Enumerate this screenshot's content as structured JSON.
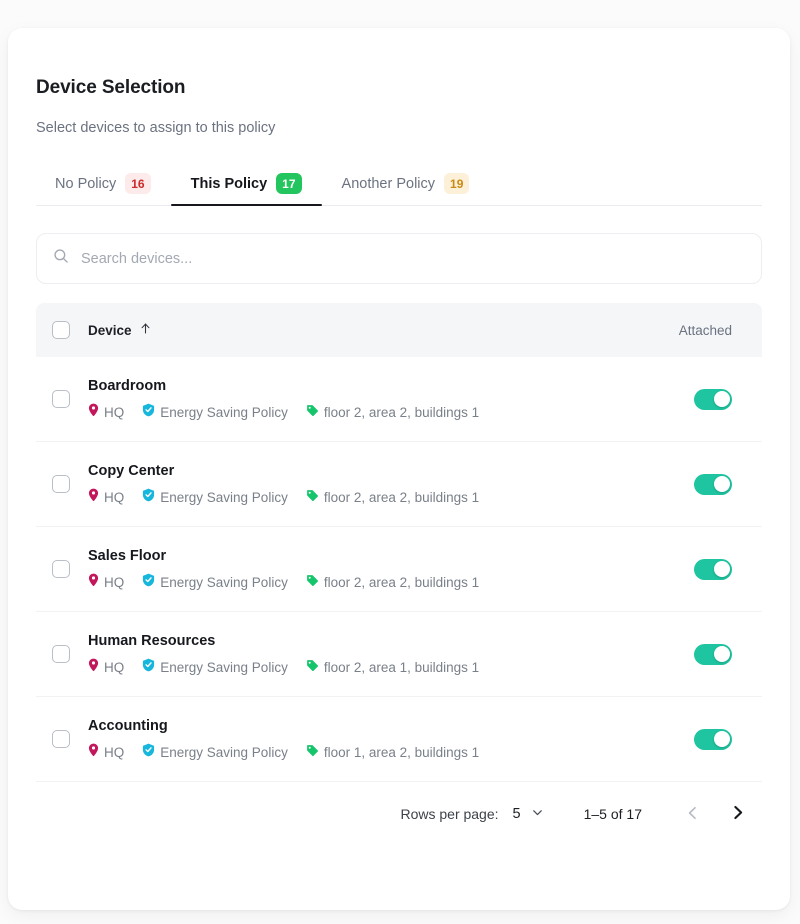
{
  "header": {
    "title": "Device Selection",
    "subtitle": "Select devices to assign to this policy"
  },
  "tabs": [
    {
      "label": "No Policy",
      "count": "16",
      "badge_style": "red",
      "active": false
    },
    {
      "label": "This Policy",
      "count": "17",
      "badge_style": "green",
      "active": true
    },
    {
      "label": "Another Policy",
      "count": "19",
      "badge_style": "amber",
      "active": false
    }
  ],
  "search": {
    "placeholder": "Search devices...",
    "value": "",
    "icon": "search-icon"
  },
  "table": {
    "columns": {
      "device": "Device",
      "attached": "Attached"
    },
    "sort": {
      "column": "Device",
      "direction": "ascending",
      "icon": "arrow-up-icon"
    },
    "select_all_checked": false,
    "rows": [
      {
        "name": "Boardroom",
        "site": "HQ",
        "policy": "Energy Saving Policy",
        "tags": "floor 2, area 2, buildings 1",
        "selected": false,
        "attached": true
      },
      {
        "name": "Copy Center",
        "site": "HQ",
        "policy": "Energy Saving Policy",
        "tags": "floor 2, area 2, buildings 1",
        "selected": false,
        "attached": true
      },
      {
        "name": "Sales Floor",
        "site": "HQ",
        "policy": "Energy Saving Policy",
        "tags": "floor 2, area 2, buildings 1",
        "selected": false,
        "attached": true
      },
      {
        "name": "Human Resources",
        "site": "HQ",
        "policy": "Energy Saving Policy",
        "tags": "floor 2, area 1, buildings 1",
        "selected": false,
        "attached": true
      },
      {
        "name": "Accounting",
        "site": "HQ",
        "policy": "Energy Saving Policy",
        "tags": "floor 1, area 2, buildings 1",
        "selected": false,
        "attached": true
      }
    ]
  },
  "pagination": {
    "rows_per_page_label": "Rows per page:",
    "rows_per_page_value": "5",
    "range_label": "1–5 of 17",
    "prev_enabled": false,
    "next_enabled": true
  },
  "icons": {
    "site": "map-pin-icon",
    "policy": "shield-check-icon",
    "tags": "tag-icon",
    "chevron_down": "chevron-down-icon",
    "prev": "chevron-left-icon",
    "next": "chevron-right-icon"
  },
  "colors": {
    "pin": "#c2185b",
    "shield": "#17b6dd",
    "tag": "#14c56b",
    "toggle_on": "#1fc4a0",
    "badge_green": "#22c55e",
    "accent_text": "#16181d"
  }
}
